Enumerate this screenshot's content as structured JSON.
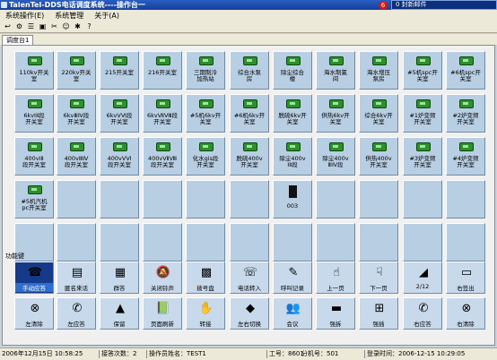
{
  "window": {
    "title": "TalenTel-DDS电话调度系统----操作台一",
    "logo_text": "6",
    "notice": "0 封新邮件"
  },
  "menu": [
    "系统操作(E)",
    "系统管理",
    "关于(A)"
  ],
  "tab": "调度台1",
  "stations": [
    "110kv开关\n室",
    "220kv开关\n室",
    "215开关室",
    "216开关室",
    "三期制冷\n加热站",
    "综合水泵\n房",
    "除尘综合\n楼",
    "海水制氯\n间",
    "海水增压\n泵房",
    "#5机spc开\n关室",
    "#6机spc开\n关室",
    "6kvⅠⅡ段\n开关室",
    "6kvⅢⅣ段\n开关室",
    "6kvⅤⅥ段\n开关室",
    "6kvⅦⅧ段\n开关室",
    "#5机6kv开\n关室",
    "#6机6kv开\n关室",
    "脱硫6kv开\n关室",
    "供热6kv开\n关室",
    "综合6kv开\n关室",
    "#1炉变频\n开关室",
    "#2炉变频\n开关室",
    "400vⅠⅡ\n段开关室",
    "400vⅢⅣ\n段开关室",
    "400vⅤⅥ\n段开关室",
    "400vⅦⅧ\n段开关室",
    "化水gis段\n开关室",
    "脱硫400v\n开关室",
    "除尘400v\nⅠⅡ段",
    "除尘400v\nⅢⅣ段",
    "供热400v\n开关室",
    "#3炉变频\n开关室",
    "#4炉变频\n开关室",
    "#5机汽机\npc开关室",
    "",
    "",
    "",
    "",
    "",
    "003",
    "",
    "",
    "",
    "",
    "",
    "",
    "",
    "",
    "",
    "",
    "",
    "",
    "",
    "",
    ""
  ],
  "function_label": "功能键",
  "functions_row1": [
    {
      "label": "手动应答",
      "icon": "handset-icon",
      "glyph": "☎",
      "active": true
    },
    {
      "label": "匿名来话",
      "icon": "anonymous-call-icon",
      "glyph": "▤"
    },
    {
      "label": "群答",
      "icon": "group-answer-icon",
      "glyph": "▦"
    },
    {
      "label": "关闭铃声",
      "icon": "bell-off-icon",
      "glyph": "🔕"
    },
    {
      "label": "拨号盘",
      "icon": "dialpad-icon",
      "glyph": "▩"
    },
    {
      "label": "电话转入",
      "icon": "phone-transfer-in-icon",
      "glyph": "☏"
    },
    {
      "label": "呼叫记录",
      "icon": "call-log-icon",
      "glyph": "✎"
    },
    {
      "label": "上一页",
      "icon": "thumb-up-icon",
      "glyph": "☝"
    },
    {
      "label": "下一页",
      "icon": "thumb-down-icon",
      "glyph": "☟"
    },
    {
      "label": "2/12",
      "icon": "page-indicator-icon",
      "glyph": "◢"
    },
    {
      "label": "右签出",
      "icon": "right-signout-icon",
      "glyph": "▭"
    }
  ],
  "functions_row2": [
    {
      "label": "左清除",
      "icon": "left-clear-icon",
      "glyph": "⊗"
    },
    {
      "label": "左应答",
      "icon": "left-answer-icon",
      "glyph": "✆"
    },
    {
      "label": "保留",
      "icon": "hold-icon",
      "glyph": "▲"
    },
    {
      "label": "页面刷新",
      "icon": "page-refresh-icon",
      "glyph": "📗"
    },
    {
      "label": "转接",
      "icon": "transfer-icon",
      "glyph": "✋"
    },
    {
      "label": "左右切换",
      "icon": "switch-icon",
      "glyph": "◆"
    },
    {
      "label": "会议",
      "icon": "conference-icon",
      "glyph": "👥"
    },
    {
      "label": "强拆",
      "icon": "force-release-icon",
      "glyph": "▬"
    },
    {
      "label": "强插",
      "icon": "force-insert-icon",
      "glyph": "⊞"
    },
    {
      "label": "右应答",
      "icon": "right-answer-icon",
      "glyph": "✆"
    },
    {
      "label": "右清除",
      "icon": "right-clear-icon",
      "glyph": "⊗"
    }
  ],
  "status": {
    "datetime": "2006年12月15日 10:58:25",
    "calls": "接答次数：2",
    "operator": "操作员姓名：TEST1",
    "workno": "工号：8601",
    "ext": "分机号：501",
    "login": "登录时间：2006-12-15  10:29:05"
  }
}
